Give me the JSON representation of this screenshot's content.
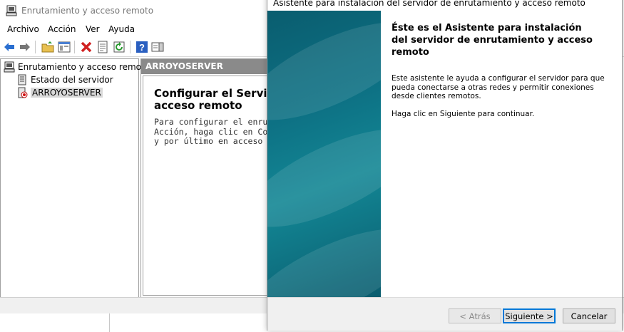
{
  "window": {
    "title": "Enrutamiento y acceso remoto"
  },
  "menu": [
    "Archivo",
    "Acción",
    "Ver",
    "Ayuda"
  ],
  "toolbar": [
    "back-icon",
    "forward-icon",
    "up-folder-icon",
    "show-hide-tree-icon",
    "delete-icon",
    "properties-icon",
    "refresh-icon",
    "help-icon",
    "show-action-pane-icon"
  ],
  "tree": {
    "root": "Enrutamiento y acceso remoto",
    "items": [
      "Estado del servidor",
      "ARROYOSERVER"
    ]
  },
  "detail": {
    "header": "ARROYOSERVER",
    "heading_line1": "Configurar el Servido",
    "heading_line2": "acceso remoto",
    "text_line1": "Para configurar el enrutamie",
    "text_line2": "Acción, haga clic en Configu",
    "text_line3": "y por último en acceso remo"
  },
  "wizard": {
    "title": "Asistente para instalación del servidor de enrutamiento y acceso remoto",
    "heading": "Éste es el Asistente para instalación del servidor de enrutamiento y acceso remoto",
    "body1": "Este asistente le ayuda a configurar el servidor para que pueda conectarse a otras redes y permitir conexiones desde clientes remotos.",
    "body2": "Haga clic en Siguiente para continuar.",
    "buttons": {
      "back": "< Atrás",
      "next": "Siguiente >",
      "cancel": "Cancelar"
    },
    "accent_color": "#0078d7",
    "sidebar_color": "#0d7184"
  }
}
